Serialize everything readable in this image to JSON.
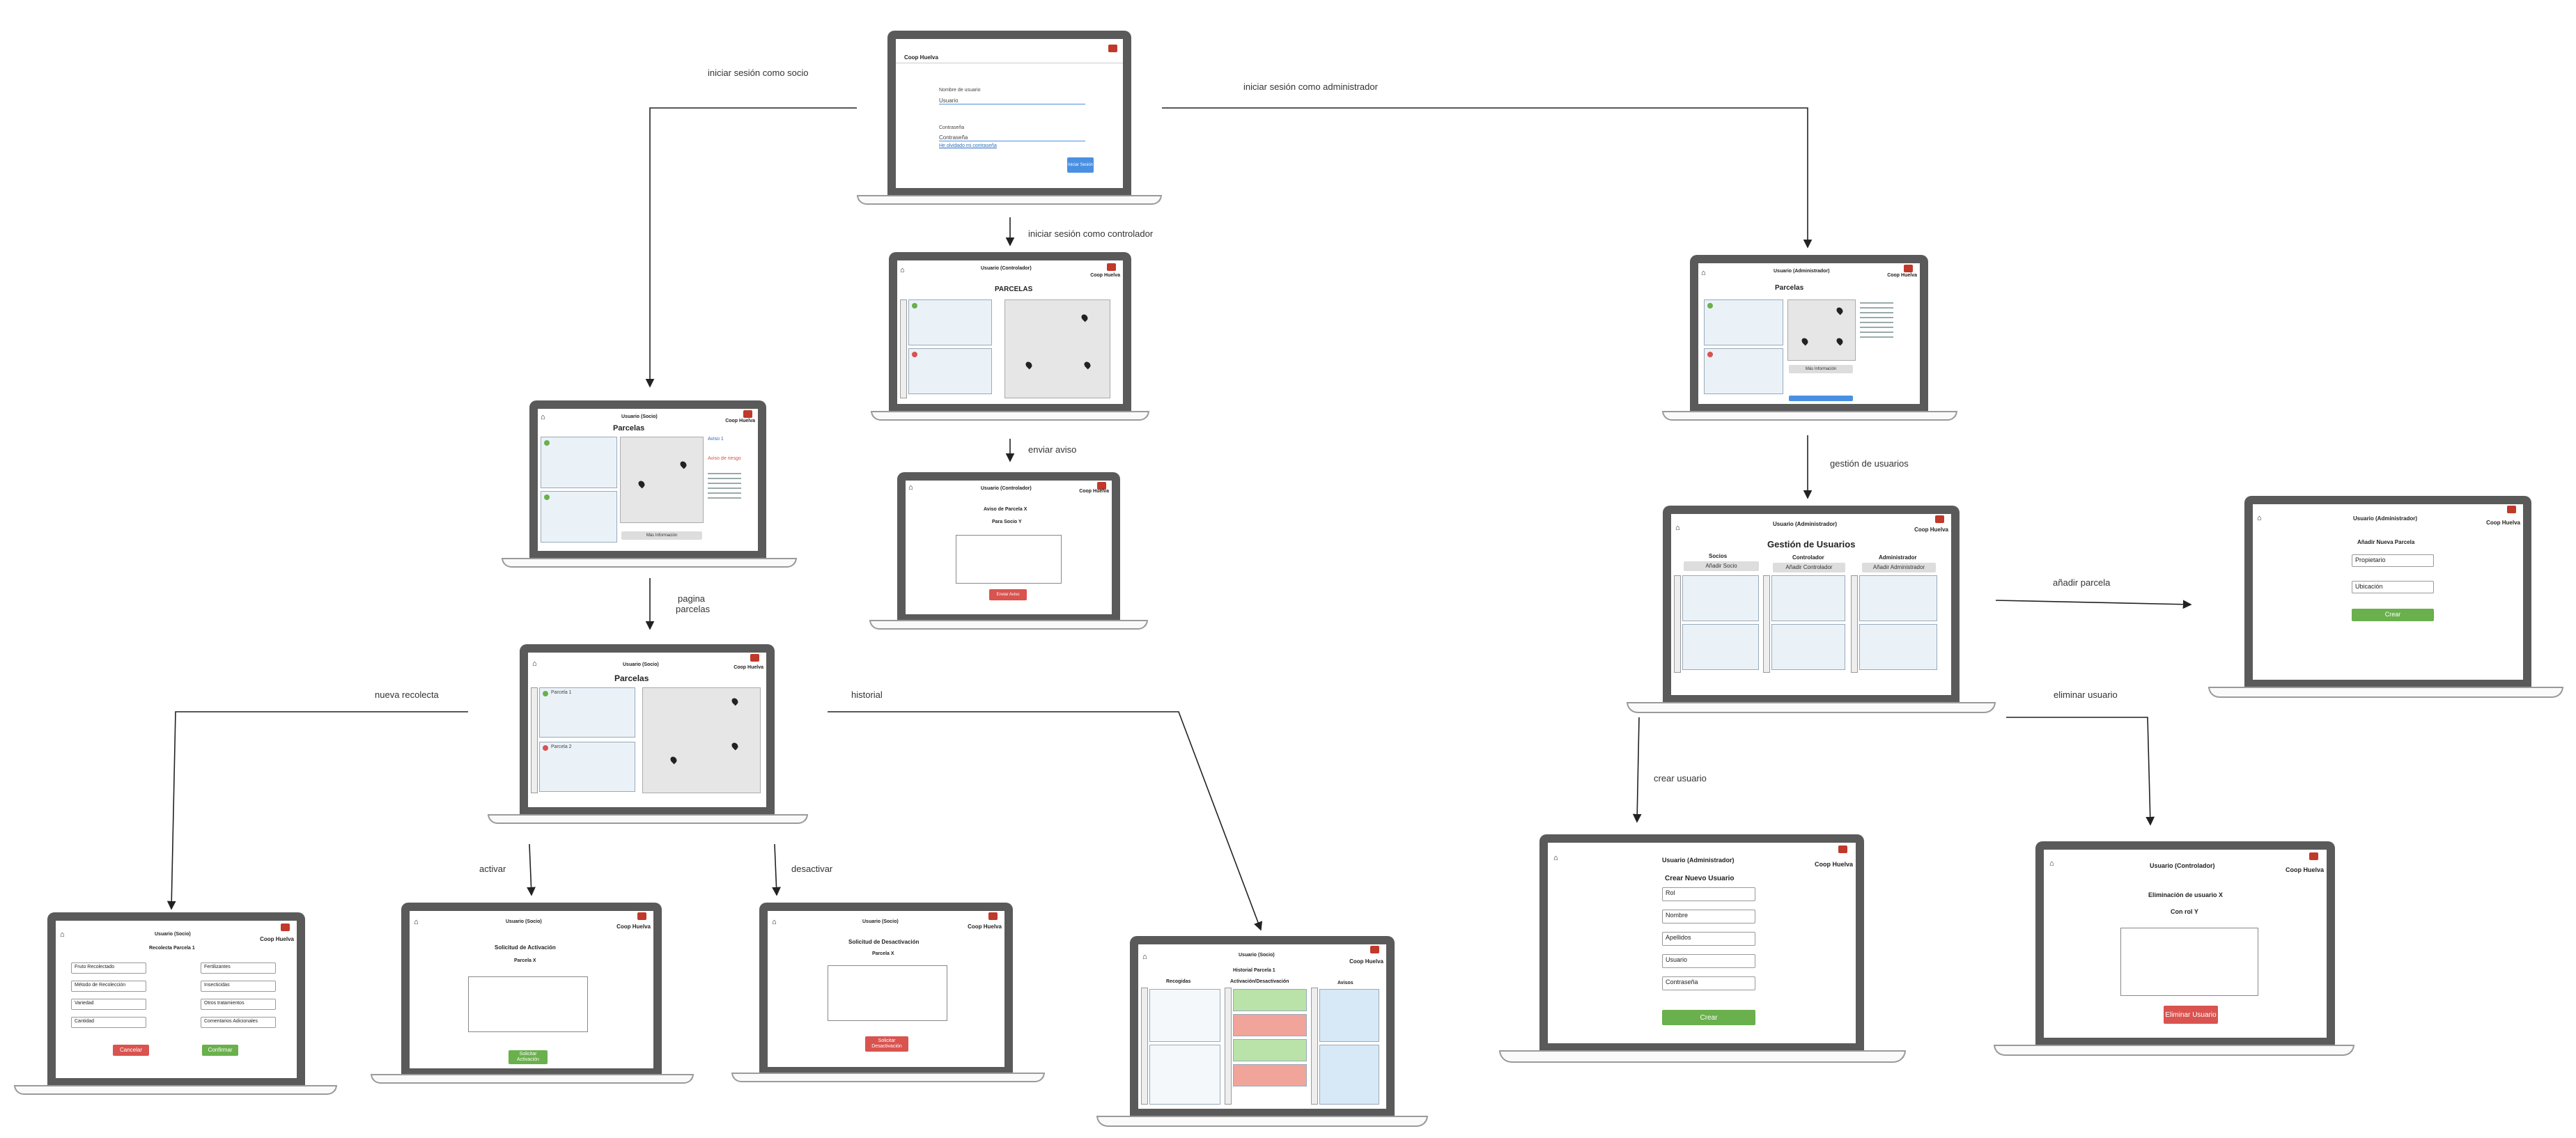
{
  "edges": {
    "socio": "iniciar sesión como socio",
    "admin": "iniciar sesión como administrador",
    "controlador": "iniciar sesión como controlador",
    "enviar_aviso": "enviar aviso",
    "gestion": "gestión de usuarios",
    "anadir_parcela": "añadir parcela",
    "pagina_parcelas_1": "pagina",
    "pagina_parcelas_2": "parcelas",
    "nueva_recolecta": "nueva recolecta",
    "historial": "historial",
    "activar": "activar",
    "desactivar": "desactivar",
    "crear_usuario": "crear usuario",
    "eliminar_usuario": "eliminar usuario"
  },
  "brand": "Coop Huelva",
  "login": {
    "user_label": "Nombre de usuario",
    "user_value": "Usuario",
    "pass_label": "Contraseña",
    "pass_value": "Contraseña",
    "forgot": "He olvidado mi contraseña",
    "btn": "Iniciar Sesión"
  },
  "controller_map": {
    "title": "Usuario (Controlador)",
    "heading": "PARCELAS"
  },
  "admin_map": {
    "title": "Usuario (Administrador)",
    "heading": "Parcelas",
    "more": "Más Información"
  },
  "socio_map": {
    "title": "Usuario (Socio)",
    "heading": "Parcelas",
    "more": "Más Información",
    "notif_1": "Aviso 1",
    "notif_2": "Aviso de riesgo"
  },
  "aviso": {
    "title": "Usuario (Controlador)",
    "h1": "Aviso de Parcela X",
    "h2": "Para Socio Y",
    "btn": "Enviar Aviso"
  },
  "parcelas": {
    "title": "Usuario (Socio)",
    "heading": "Parcelas",
    "p1": "Parcela 1",
    "p2": "Parcela 2"
  },
  "gestion": {
    "title": "Usuario (Administrador)",
    "heading": "Gestión de Usuarios",
    "col1": "Socios",
    "col2": "Controlador",
    "col3": "Administrador",
    "add1": "Añadir Socio",
    "add2": "Añadir Controlador",
    "add3": "Añadir Administrador"
  },
  "nueva_parcela": {
    "title": "Usuario (Administrador)",
    "heading": "Añadir Nueva Parcela",
    "f1": "Propietario",
    "f2": "Ubicación",
    "btn": "Crear"
  },
  "recolecta": {
    "title": "Usuario (Socio)",
    "heading": "Recolecta Parcela 1",
    "f1": "Fruto Recolectado",
    "f2": "Método de Recolección",
    "f3": "Variedad",
    "f4": "Cantidad",
    "f5": "Fertilizantes",
    "f6": "Insecticidas",
    "f7": "Otros tratamientos",
    "f8": "Comentarios Adicionales",
    "cancel": "Cancelar",
    "confirm": "Confirmar"
  },
  "activacion": {
    "title": "Usuario (Socio)",
    "h1": "Solicitud de Activación",
    "h2": "Parcela X",
    "btn": "Solicitar Activación"
  },
  "desactivacion": {
    "title": "Usuario (Socio)",
    "h1": "Solicitud de Desactivación",
    "h2": "Parcela X",
    "btn": "Solicitar Desactivación"
  },
  "historial": {
    "title": "Usuario (Socio)",
    "heading": "Historial Parcela 1",
    "c1": "Recogidas",
    "c2": "Activación/Desactivación",
    "c3": "Avisos"
  },
  "crear": {
    "title": "Usuario (Administrador)",
    "heading": "Crear Nuevo Usuario",
    "f0": "Rol",
    "f1": "Nombre",
    "f2": "Apellidos",
    "f3": "Usuario",
    "f4": "Contraseña",
    "btn": "Crear"
  },
  "eliminar": {
    "title": "Usuario (Controlador)",
    "h1": "Eliminación de usuario X",
    "h2": "Con rol Y",
    "btn": "Eliminar Usuario"
  }
}
